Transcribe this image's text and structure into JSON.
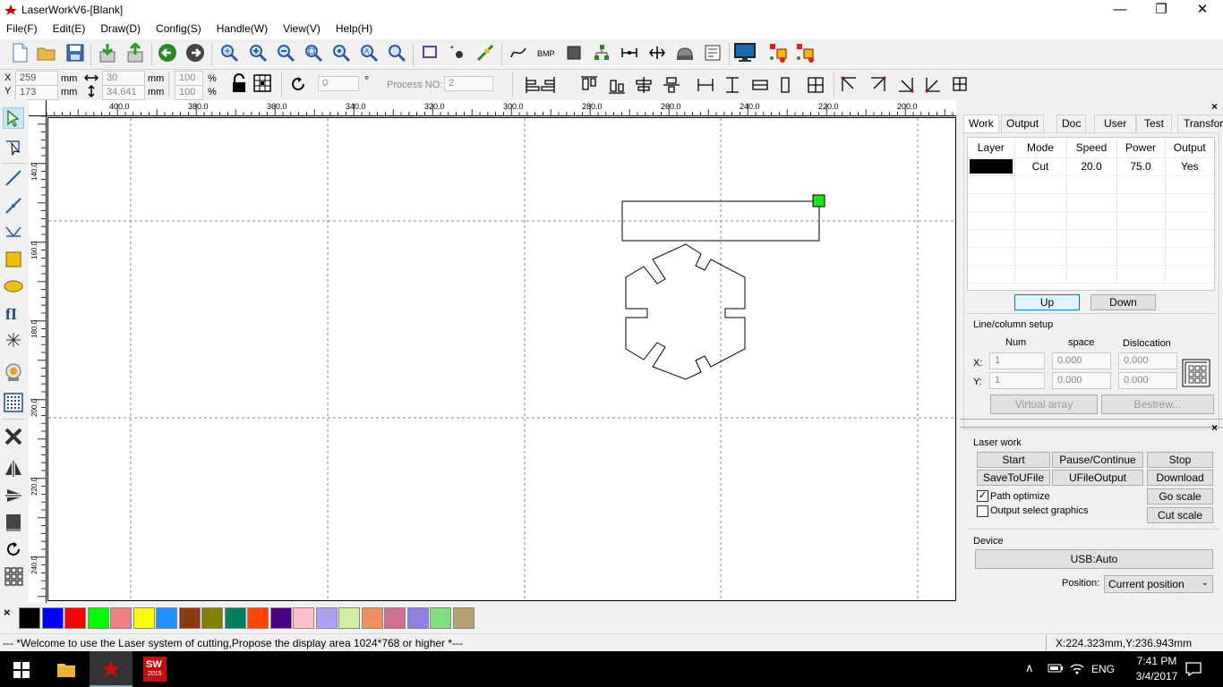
{
  "app": {
    "title": "LaserWorkV6-[Blank]",
    "minimize": "—",
    "restore": "❐",
    "close": "✕"
  },
  "menu": [
    "File(F)",
    "Edit(E)",
    "Draw(D)",
    "Config(S)",
    "Handle(W)",
    "View(V)",
    "Help(H)"
  ],
  "coords": {
    "x_label": "X",
    "y_label": "Y",
    "x_value": "259",
    "y_value": "173",
    "unit": "mm",
    "width": "30",
    "height": "34.641",
    "scale_w": "100",
    "scale_h": "100",
    "percent": "%",
    "rotate_value": "0",
    "degree": "°",
    "process_label": "Process NO:",
    "process_value": "2"
  },
  "ruler": {
    "h_labels": [
      "400.0",
      "380.0",
      "360.0",
      "340.0",
      "320.0",
      "300.0",
      "280.0",
      "260.0",
      "240.0",
      "220.0",
      "200.0"
    ],
    "v_labels": [
      "140.0",
      "160.0",
      "180.0",
      "200.0",
      "220.0",
      "240.0"
    ]
  },
  "palette": {
    "close": "×",
    "colors": [
      "#000000",
      "#0000ff",
      "#ff0000",
      "#00ff00",
      "#f08080",
      "#ffff00",
      "#1e90ff",
      "#8b3a0f",
      "#808000",
      "#008060",
      "#ff4500",
      "#4b0082",
      "#ffc0cb",
      "#b0a0f0",
      "#d0f0a0",
      "#f09060",
      "#d07090",
      "#9080e0",
      "#80e080",
      "#b8a070"
    ]
  },
  "panel": {
    "tabs": [
      "Work",
      "Output",
      "Doc",
      "User",
      "Test",
      "Transform"
    ],
    "columns": [
      "Layer",
      "Mode",
      "Speed",
      "Power",
      "Output"
    ],
    "rows": [
      {
        "color": "#000000",
        "mode": "Cut",
        "speed": "20.0",
        "power": "75.0",
        "output": "Yes"
      }
    ],
    "up": "Up",
    "down": "Down",
    "linecol": {
      "title": "Line/column setup",
      "num": "Num",
      "space": "space",
      "dislocation": "Dislocation",
      "x_label": "X:",
      "y_label": "Y:",
      "x_num": "1",
      "y_num": "1",
      "x_space": "0.000",
      "y_space": "0.000",
      "x_disloc": "0.000",
      "y_disloc": "0.000",
      "virtual_array": "Virtual array",
      "bestrew": "Bestrew..."
    },
    "laserwork": {
      "title": "Laser work",
      "start": "Start",
      "pause": "Pause/Continue",
      "stop": "Stop",
      "save_u": "SaveToUFile",
      "ufile_out": "UFileOutput",
      "download": "Download",
      "path_opt": "Path optimize",
      "path_opt_checked": true,
      "output_sel": "Output select graphics",
      "output_sel_checked": false,
      "go_scale": "Go scale",
      "cut_scale": "Cut scale"
    },
    "device": {
      "title": "Device",
      "usb": "USB:Auto",
      "position_label": "Position:",
      "position_value": "Current position"
    }
  },
  "status": {
    "message": "--- *Welcome to use the Laser system of cutting,Propose the display area 1024*768 or higher *---",
    "coords": "X:224.323mm,Y:236.943mm"
  },
  "taskbar": {
    "lang": "ENG",
    "time": "7:41 PM",
    "date": "3/4/2017"
  }
}
